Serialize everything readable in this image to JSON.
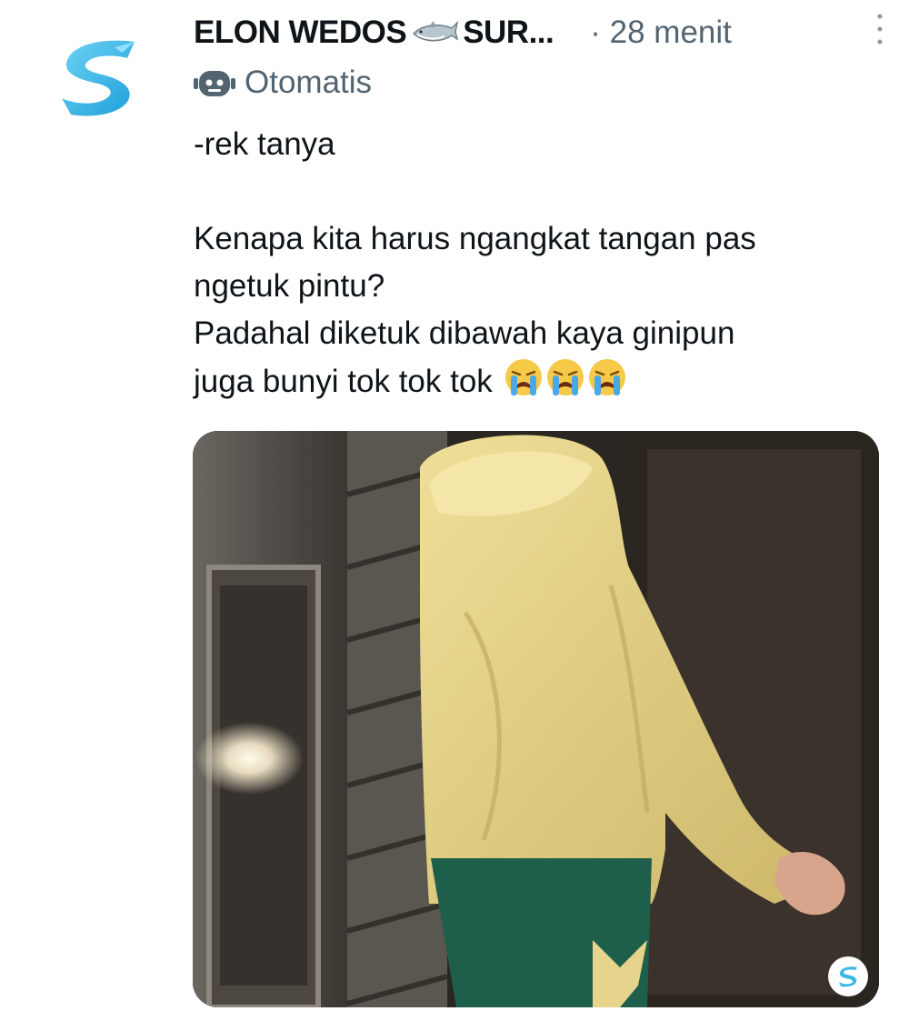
{
  "post": {
    "author_name": "ELON WEDOS",
    "author_suffix": "SUR...",
    "time_separator": "·",
    "timestamp": "28 menit",
    "automated_label": "Otomatis",
    "lines": [
      "-rek tanya",
      "Kenapa kita harus ngangkat tangan pas",
      "ngetuk pintu?",
      "Padahal diketuk dibawah kaya ginipun",
      "juga bunyi tok tok tok"
    ],
    "emoji_count": 3
  },
  "colors": {
    "primary_text": "#0f1419",
    "secondary_text": "#536471",
    "avatar_accent": "#3ab7e6",
    "hoodie": "#e8d58a",
    "pants": "#1d5f4b"
  },
  "icons": {
    "avatar": "shark-s-logo-icon",
    "name_emoji": "shark-icon",
    "automated": "robot-icon",
    "more": "more-vertical-icon",
    "emoji": "crying-face-icon",
    "watermark": "s-logo-icon"
  }
}
